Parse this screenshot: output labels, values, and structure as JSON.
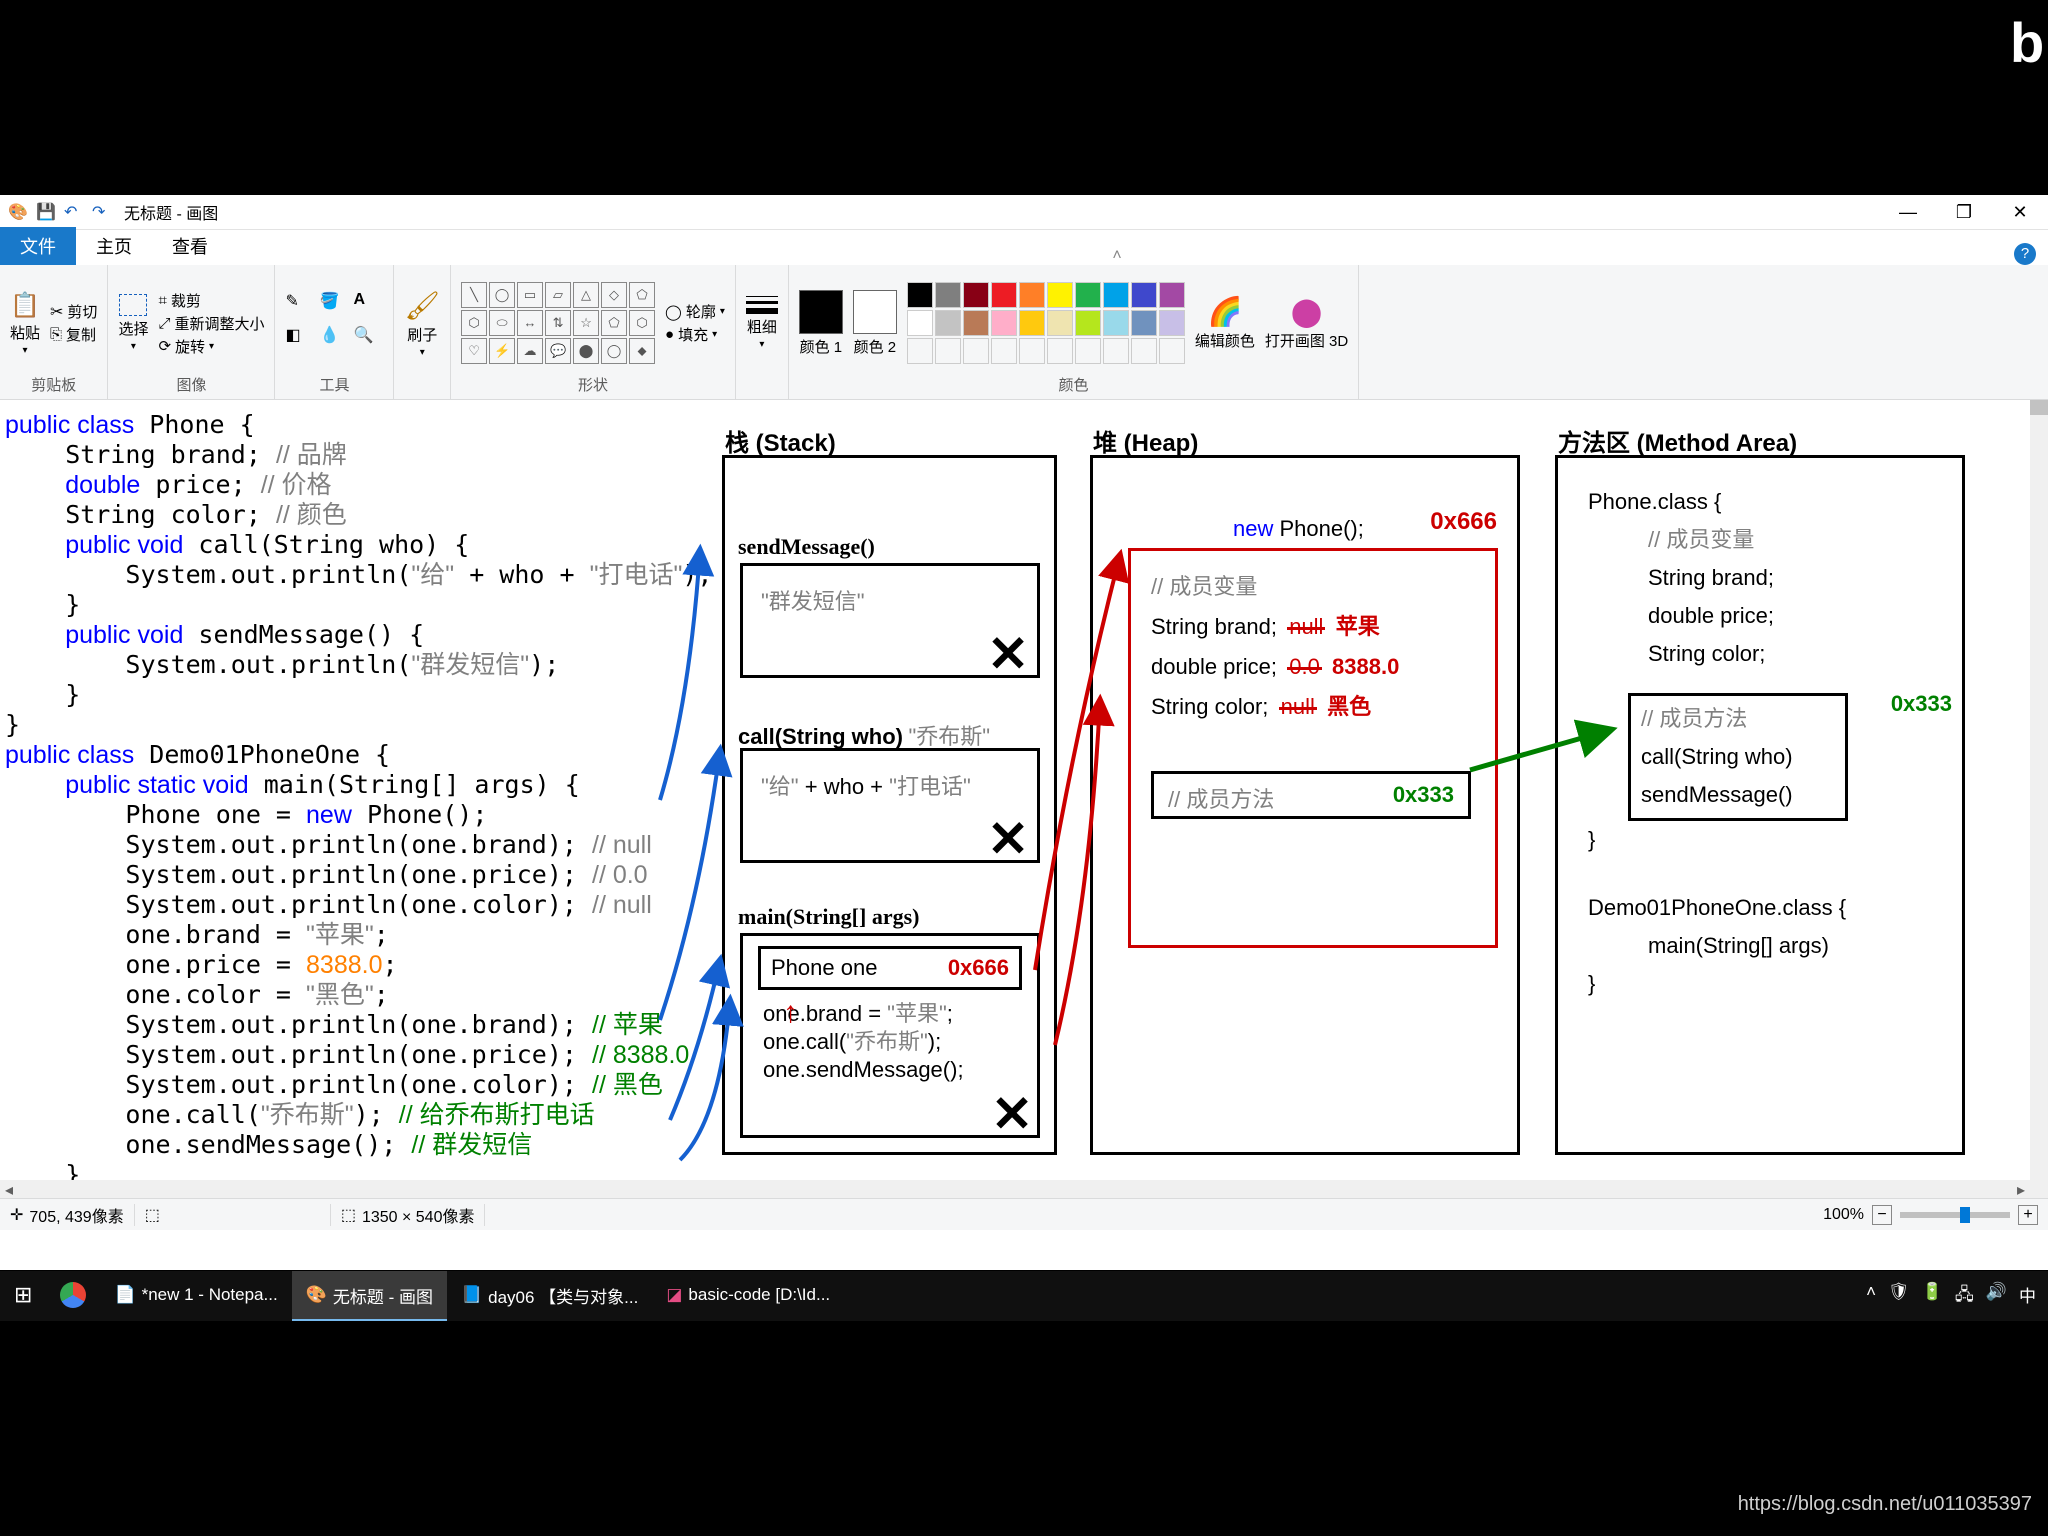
{
  "window": {
    "app_icon": "paint-icon",
    "title": "无标题 - 画图",
    "tabs": {
      "file": "文件",
      "home": "主页",
      "view": "查看"
    },
    "controls": {
      "min": "—",
      "max": "❐",
      "close": "✕"
    }
  },
  "ribbon": {
    "clipboard": {
      "label": "剪贴板",
      "paste": "粘贴",
      "cut": "剪切",
      "copy": "复制"
    },
    "image": {
      "label": "图像",
      "select": "选择",
      "crop": "裁剪",
      "resize": "重新调整大小",
      "rotate": "旋转"
    },
    "tools": {
      "label": "工具"
    },
    "brush": {
      "label": "刷子"
    },
    "shapes": {
      "label": "形状",
      "outline": "轮廓",
      "fill": "填充"
    },
    "thick": {
      "label": "粗细"
    },
    "colors": {
      "label": "颜色",
      "c1": "颜色 1",
      "c2": "颜色 2",
      "edit": "编辑颜色",
      "open3d": "打开画图 3D"
    }
  },
  "statusbar": {
    "pos_icon": "✛",
    "pos": "705, 439像素",
    "sel_icon": "⬚",
    "sel": "",
    "size_icon": "⬚",
    "size": "1350 × 540像素",
    "zoom": "100%"
  },
  "canvas": {
    "code": "public class Phone {\n    String brand; // 品牌\n    double price; // 价格\n    String color; // 颜色\n    public void call(String who) {\n        System.out.println(\"给\" + who + \"打电话\");\n    }\n    public void sendMessage() {\n        System.out.println(\"群发短信\");\n    }\n}\npublic class Demo01PhoneOne {\n    public static void main(String[] args) {\n        Phone one = new Phone();\n        System.out.println(one.brand); // null\n        System.out.println(one.price); // 0.0\n        System.out.println(one.color); // null\n        one.brand = \"苹果\";\n        one.price = 8388.0;\n        one.color = \"黑色\";\n        System.out.println(one.brand); // 苹果\n        System.out.println(one.price); // 8388.0\n        System.out.println(one.color); // 黑色\n        one.call(\"乔布斯\"); // 给乔布斯打电话\n        one.sendMessage(); // 群发短信\n    }\n}",
    "stack_title": "栈  (Stack)",
    "heap_title": "堆  (Heap)",
    "method_title": "方法区  (Method Area)",
    "frame_sendMessage": "sendMessage()",
    "frame_sendMessage_body": "\"群发短信\"",
    "frame_call": "call(String who)",
    "frame_call_arg": "\"乔布斯\"",
    "frame_call_body": "\"给\" + who + \"打电话\"",
    "frame_main": "main(String[] args)",
    "main_var": "Phone  one",
    "main_addr": "0x666",
    "main_body": "one.brand = \"苹果\";\none.call(\"乔布斯\");\none.sendMessage();",
    "heap_new": "new Phone();",
    "heap_addr": "0x666",
    "heap_fields_title": "// 成员变量",
    "heap_field1": "String brand;",
    "heap_field1_old": "null",
    "heap_field1_new": "苹果",
    "heap_field2": "double price;",
    "heap_field2_old": "0.0",
    "heap_field2_new": "8388.0",
    "heap_field3": "String color;",
    "heap_field3_old": "null",
    "heap_field3_new": "黑色",
    "heap_methods_title": "// 成员方法",
    "heap_methods_addr": "0x333",
    "method_class1": "Phone.class {",
    "method_fields_title": "// 成员变量",
    "method_f1": "String brand;",
    "method_f2": "double price;",
    "method_f3": "String color;",
    "method_methods_title": "// 成员方法",
    "method_methods_addr": "0x333",
    "method_m1": "call(String who)",
    "method_m2": "sendMessage()",
    "method_close1": "}",
    "method_class2": "Demo01PhoneOne.class {",
    "method_main": "main(String[] args)",
    "method_close2": "}"
  },
  "taskbar": {
    "items": [
      {
        "icon": "win",
        "label": ""
      },
      {
        "icon": "chrome",
        "label": ""
      },
      {
        "icon": "notepad",
        "label": "*new 1 - Notepa..."
      },
      {
        "icon": "paint",
        "label": "无标题 - 画图"
      },
      {
        "icon": "doc",
        "label": "day06 【类与对象..."
      },
      {
        "icon": "idea",
        "label": "basic-code [D:\\Id..."
      }
    ],
    "tray": {
      "ime": "中"
    }
  },
  "watermark": "https://blog.csdn.net/u011035397"
}
